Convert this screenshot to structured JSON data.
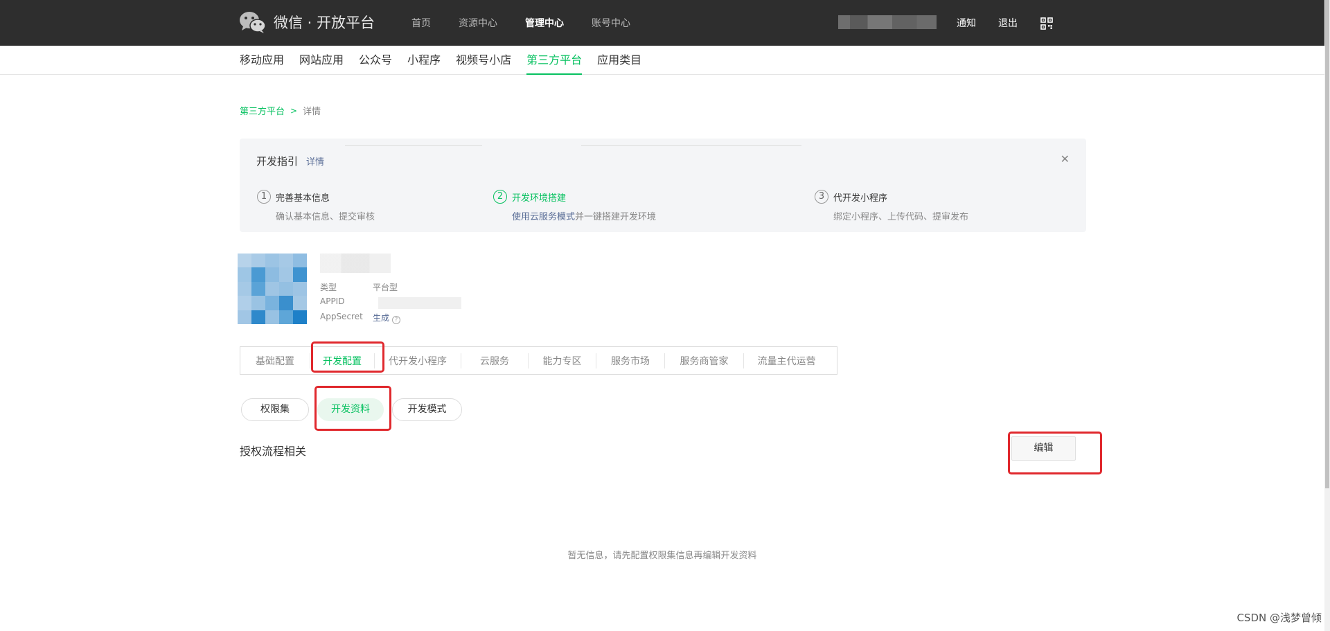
{
  "header": {
    "logo_text": "微信 · 开放平台",
    "nav": [
      "首页",
      "资源中心",
      "管理中心",
      "账号中心"
    ],
    "active_nav": "管理中心",
    "notify": "通知",
    "logout": "退出"
  },
  "category_nav": [
    "移动应用",
    "网站应用",
    "公众号",
    "小程序",
    "视频号小店",
    "第三方平台",
    "应用类目"
  ],
  "breadcrumb": {
    "parent": "第三方平台",
    "separator": ">",
    "current": "详情"
  },
  "guide": {
    "title": "开发指引",
    "detail_link": "详情",
    "close": "✕",
    "steps": [
      {
        "num": "1",
        "title": "完善基本信息",
        "desc": "确认基本信息、提交审核"
      },
      {
        "num": "2",
        "title": "开发环境搭建",
        "desc_link": "使用云服务模式",
        "desc": "并一键搭建开发环境"
      },
      {
        "num": "3",
        "title": "代开发小程序",
        "desc": "绑定小程序、上传代码、提审发布"
      }
    ]
  },
  "app_info": {
    "type_label": "类型",
    "type_value": "平台型",
    "appid_label": "APPID",
    "secret_label": "AppSecret",
    "secret_action": "生成",
    "help_icon": "?"
  },
  "tabs": [
    "基础配置",
    "开发配置",
    "代开发小程序",
    "云服务",
    "能力专区",
    "服务市场",
    "服务商管家",
    "流量主代运营"
  ],
  "active_tab": "开发配置",
  "sub_tabs": [
    "权限集",
    "开发资料",
    "开发模式"
  ],
  "active_sub_tab": "开发资料",
  "section": {
    "title": "授权流程相关",
    "edit_button": "编辑"
  },
  "empty_message": "暂无信息，请先配置权限集信息再编辑开发资料",
  "watermark": "CSDN @浅梦曾倾",
  "colors": {
    "brand_green": "#07c160",
    "link_blue": "#576b95",
    "highlight_red": "#e0282d",
    "topbar": "#2e2e2e"
  }
}
